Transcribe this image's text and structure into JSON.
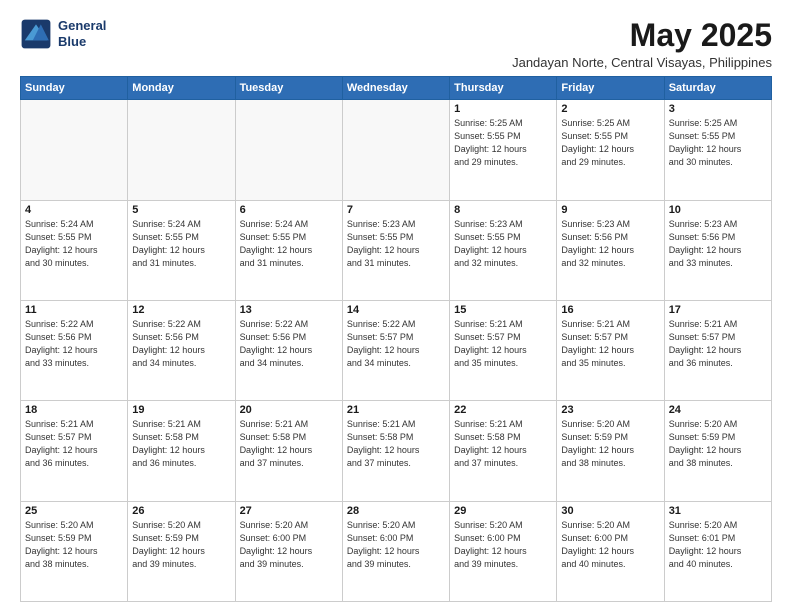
{
  "logo": {
    "line1": "General",
    "line2": "Blue"
  },
  "title": "May 2025",
  "subtitle": "Jandayan Norte, Central Visayas, Philippines",
  "weekdays": [
    "Sunday",
    "Monday",
    "Tuesday",
    "Wednesday",
    "Thursday",
    "Friday",
    "Saturday"
  ],
  "weeks": [
    [
      {
        "day": "",
        "info": ""
      },
      {
        "day": "",
        "info": ""
      },
      {
        "day": "",
        "info": ""
      },
      {
        "day": "",
        "info": ""
      },
      {
        "day": "1",
        "info": "Sunrise: 5:25 AM\nSunset: 5:55 PM\nDaylight: 12 hours\nand 29 minutes."
      },
      {
        "day": "2",
        "info": "Sunrise: 5:25 AM\nSunset: 5:55 PM\nDaylight: 12 hours\nand 29 minutes."
      },
      {
        "day": "3",
        "info": "Sunrise: 5:25 AM\nSunset: 5:55 PM\nDaylight: 12 hours\nand 30 minutes."
      }
    ],
    [
      {
        "day": "4",
        "info": "Sunrise: 5:24 AM\nSunset: 5:55 PM\nDaylight: 12 hours\nand 30 minutes."
      },
      {
        "day": "5",
        "info": "Sunrise: 5:24 AM\nSunset: 5:55 PM\nDaylight: 12 hours\nand 31 minutes."
      },
      {
        "day": "6",
        "info": "Sunrise: 5:24 AM\nSunset: 5:55 PM\nDaylight: 12 hours\nand 31 minutes."
      },
      {
        "day": "7",
        "info": "Sunrise: 5:23 AM\nSunset: 5:55 PM\nDaylight: 12 hours\nand 31 minutes."
      },
      {
        "day": "8",
        "info": "Sunrise: 5:23 AM\nSunset: 5:55 PM\nDaylight: 12 hours\nand 32 minutes."
      },
      {
        "day": "9",
        "info": "Sunrise: 5:23 AM\nSunset: 5:56 PM\nDaylight: 12 hours\nand 32 minutes."
      },
      {
        "day": "10",
        "info": "Sunrise: 5:23 AM\nSunset: 5:56 PM\nDaylight: 12 hours\nand 33 minutes."
      }
    ],
    [
      {
        "day": "11",
        "info": "Sunrise: 5:22 AM\nSunset: 5:56 PM\nDaylight: 12 hours\nand 33 minutes."
      },
      {
        "day": "12",
        "info": "Sunrise: 5:22 AM\nSunset: 5:56 PM\nDaylight: 12 hours\nand 34 minutes."
      },
      {
        "day": "13",
        "info": "Sunrise: 5:22 AM\nSunset: 5:56 PM\nDaylight: 12 hours\nand 34 minutes."
      },
      {
        "day": "14",
        "info": "Sunrise: 5:22 AM\nSunset: 5:57 PM\nDaylight: 12 hours\nand 34 minutes."
      },
      {
        "day": "15",
        "info": "Sunrise: 5:21 AM\nSunset: 5:57 PM\nDaylight: 12 hours\nand 35 minutes."
      },
      {
        "day": "16",
        "info": "Sunrise: 5:21 AM\nSunset: 5:57 PM\nDaylight: 12 hours\nand 35 minutes."
      },
      {
        "day": "17",
        "info": "Sunrise: 5:21 AM\nSunset: 5:57 PM\nDaylight: 12 hours\nand 36 minutes."
      }
    ],
    [
      {
        "day": "18",
        "info": "Sunrise: 5:21 AM\nSunset: 5:57 PM\nDaylight: 12 hours\nand 36 minutes."
      },
      {
        "day": "19",
        "info": "Sunrise: 5:21 AM\nSunset: 5:58 PM\nDaylight: 12 hours\nand 36 minutes."
      },
      {
        "day": "20",
        "info": "Sunrise: 5:21 AM\nSunset: 5:58 PM\nDaylight: 12 hours\nand 37 minutes."
      },
      {
        "day": "21",
        "info": "Sunrise: 5:21 AM\nSunset: 5:58 PM\nDaylight: 12 hours\nand 37 minutes."
      },
      {
        "day": "22",
        "info": "Sunrise: 5:21 AM\nSunset: 5:58 PM\nDaylight: 12 hours\nand 37 minutes."
      },
      {
        "day": "23",
        "info": "Sunrise: 5:20 AM\nSunset: 5:59 PM\nDaylight: 12 hours\nand 38 minutes."
      },
      {
        "day": "24",
        "info": "Sunrise: 5:20 AM\nSunset: 5:59 PM\nDaylight: 12 hours\nand 38 minutes."
      }
    ],
    [
      {
        "day": "25",
        "info": "Sunrise: 5:20 AM\nSunset: 5:59 PM\nDaylight: 12 hours\nand 38 minutes."
      },
      {
        "day": "26",
        "info": "Sunrise: 5:20 AM\nSunset: 5:59 PM\nDaylight: 12 hours\nand 39 minutes."
      },
      {
        "day": "27",
        "info": "Sunrise: 5:20 AM\nSunset: 6:00 PM\nDaylight: 12 hours\nand 39 minutes."
      },
      {
        "day": "28",
        "info": "Sunrise: 5:20 AM\nSunset: 6:00 PM\nDaylight: 12 hours\nand 39 minutes."
      },
      {
        "day": "29",
        "info": "Sunrise: 5:20 AM\nSunset: 6:00 PM\nDaylight: 12 hours\nand 39 minutes."
      },
      {
        "day": "30",
        "info": "Sunrise: 5:20 AM\nSunset: 6:00 PM\nDaylight: 12 hours\nand 40 minutes."
      },
      {
        "day": "31",
        "info": "Sunrise: 5:20 AM\nSunset: 6:01 PM\nDaylight: 12 hours\nand 40 minutes."
      }
    ]
  ]
}
